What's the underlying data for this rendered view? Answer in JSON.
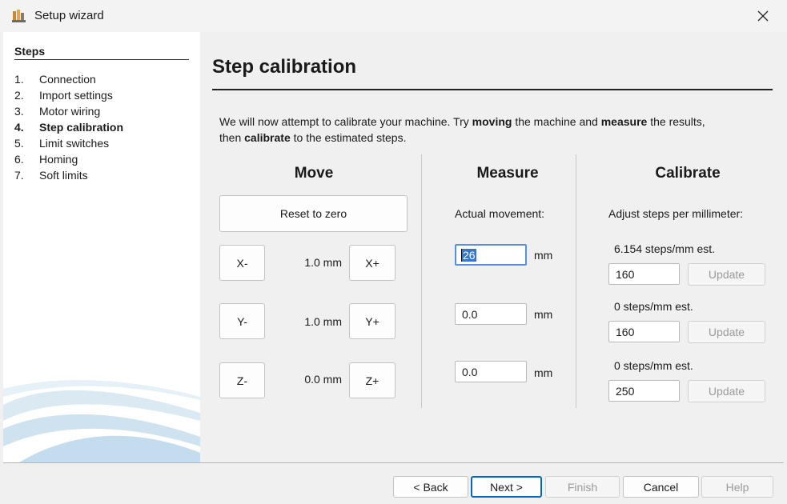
{
  "window": {
    "title": "Setup wizard"
  },
  "sidebar": {
    "heading": "Steps",
    "steps": [
      {
        "num": "1.",
        "label": "Connection"
      },
      {
        "num": "2.",
        "label": "Import settings"
      },
      {
        "num": "3.",
        "label": "Motor wiring"
      },
      {
        "num": "4.",
        "label": "Step calibration"
      },
      {
        "num": "5.",
        "label": "Limit switches"
      },
      {
        "num": "6.",
        "label": "Homing"
      },
      {
        "num": "7.",
        "label": "Soft limits"
      }
    ],
    "active_step": 4
  },
  "page": {
    "title": "Step calibration",
    "intro": {
      "t1": "We will now attempt to calibrate your machine. Try ",
      "b1": "moving",
      "t2": " the machine and ",
      "b2": "measure",
      "t3": " the results,",
      "t4": "then ",
      "b3": "calibrate",
      "t5": " to the estimated steps."
    }
  },
  "move": {
    "heading": "Move",
    "reset_label": "Reset to zero",
    "axes": [
      {
        "minus": "X-",
        "plus": "X+",
        "distance": "1.0 mm"
      },
      {
        "minus": "Y-",
        "plus": "Y+",
        "distance": "1.0 mm"
      },
      {
        "minus": "Z-",
        "plus": "Z+",
        "distance": "0.0 mm"
      }
    ]
  },
  "measure": {
    "heading": "Measure",
    "label": "Actual movement:",
    "unit": "mm",
    "values": [
      "26",
      "0.0",
      "0.0"
    ]
  },
  "calibrate": {
    "heading": "Calibrate",
    "label": "Adjust steps per millimeter:",
    "update_label": "Update",
    "rows": [
      {
        "estimate": "6.154 steps/mm est.",
        "value": "160"
      },
      {
        "estimate": "0 steps/mm est.",
        "value": "160"
      },
      {
        "estimate": "0 steps/mm est.",
        "value": "250"
      }
    ]
  },
  "footer": {
    "back": "< Back",
    "next": "Next >",
    "finish": "Finish",
    "cancel": "Cancel",
    "help": "Help"
  },
  "colors": {
    "accent": "#0067c0",
    "selection": "#3874c9",
    "disabled_text": "#9a9a9a"
  },
  "icons": {
    "app": "cnc-app-icon",
    "close": "close-icon"
  }
}
